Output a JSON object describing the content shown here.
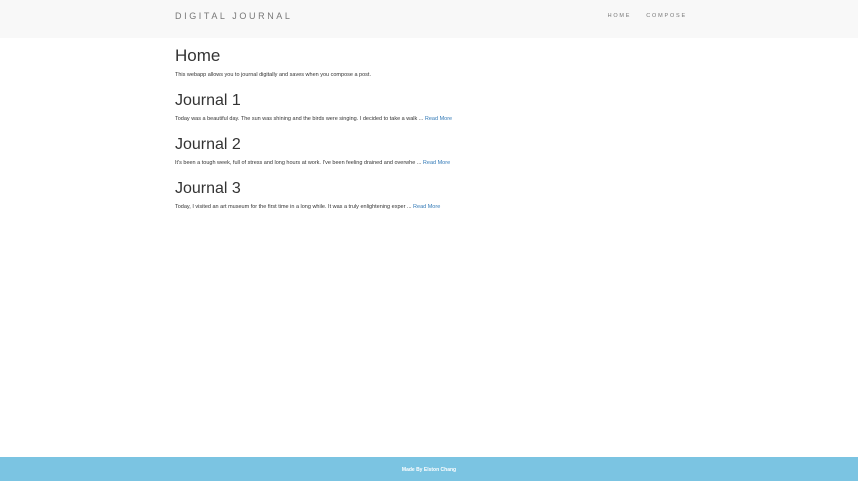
{
  "header": {
    "brand": "DIGITAL JOURNAL",
    "nav": [
      {
        "label": "HOME"
      },
      {
        "label": "COMPOSE"
      }
    ]
  },
  "main": {
    "title": "Home",
    "intro": "This webapp allows you to journal digitally and saves when you compose a post.",
    "read_more_label": "Read More",
    "posts": [
      {
        "title": "Journal 1",
        "excerpt": "Today was a beautiful day. The sun was shining and the birds were singing. I decided to take a walk ..."
      },
      {
        "title": "Journal 2",
        "excerpt": "It's been a tough week, full of stress and long hours at work. I've been feeling drained and overwhe ..."
      },
      {
        "title": "Journal 3",
        "excerpt": "Today, I visited an art museum for the first time in a long while. It was a truly enlightening exper ..."
      }
    ]
  },
  "footer": {
    "text": "Made By Elston Chang"
  },
  "colors": {
    "navbar_bg": "#f8f8f8",
    "footer_bg": "#7bc4e2",
    "link": "#337ab7"
  }
}
